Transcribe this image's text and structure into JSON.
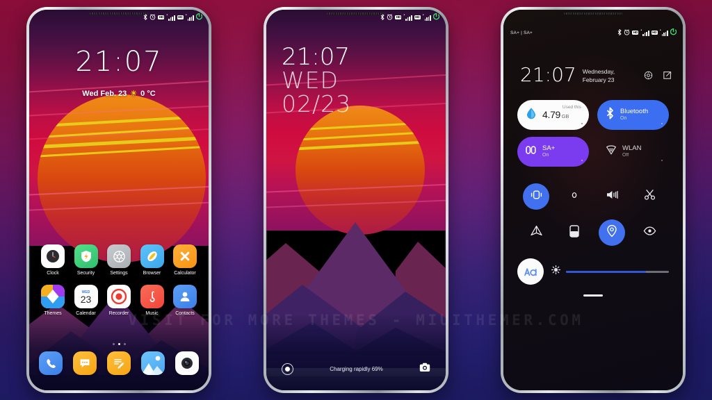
{
  "wallpaper_theme": "synthwave-sunset",
  "watermark": "VISIT FOR MORE THEMES - MIUITHEMER.COM",
  "colors": {
    "bg_top": "#b8114a",
    "bg_bottom": "#23227e",
    "accent_blue": "#3b6ef0",
    "accent_purple": "#7b3cf0",
    "battery_green": "#3fd96a",
    "sun_yellow": "#e8d21b"
  },
  "phone1": {
    "name": "home-screen",
    "statusbar": {
      "icons": [
        "bluetooth-icon",
        "alarm-icon",
        "hd-icon",
        "signal-bars-icon",
        "hd-icon",
        "signal-bars-icon",
        "battery-charging-icon"
      ]
    },
    "clock": "21:07",
    "date": "Wed Feb. 23",
    "weather_icon": "sun-icon",
    "temperature": "0 °C",
    "apps_row1": [
      {
        "label": "Clock",
        "icon": "clock-icon"
      },
      {
        "label": "Security",
        "icon": "shield-icon"
      },
      {
        "label": "Settings",
        "icon": "gear-icon"
      },
      {
        "label": "Browser",
        "icon": "browser-icon"
      },
      {
        "label": "Calculator",
        "icon": "calculator-icon"
      }
    ],
    "apps_row2": [
      {
        "label": "Themes",
        "icon": "themes-icon"
      },
      {
        "label": "Calendar",
        "icon": "calendar-icon",
        "day_name": "WED",
        "day_num": "23"
      },
      {
        "label": "Recorder",
        "icon": "recorder-icon"
      },
      {
        "label": "Music",
        "icon": "music-note-icon"
      },
      {
        "label": "Contacts",
        "icon": "person-icon"
      }
    ],
    "page_dots": 3,
    "page_active": 1,
    "dock": [
      {
        "icon": "phone-icon"
      },
      {
        "icon": "messages-icon"
      },
      {
        "icon": "notes-icon"
      },
      {
        "icon": "gallery-icon"
      },
      {
        "icon": "camera-icon"
      }
    ]
  },
  "phone2": {
    "name": "lock-screen",
    "statusbar": {
      "icons": [
        "bluetooth-icon",
        "alarm-icon",
        "hd-icon",
        "signal-bars-icon",
        "hd-icon",
        "signal-bars-icon",
        "battery-charging-icon"
      ]
    },
    "clock": "21:07",
    "day_of_week": "WED",
    "date": "02/23",
    "charging_text": "Charging rapidly 69%",
    "left_shortcut": "flashlight-icon",
    "right_shortcut": "camera-icon"
  },
  "phone3": {
    "name": "control-center",
    "statusbar_left": "SA+ | SA+",
    "statusbar": {
      "icons": [
        "bluetooth-icon",
        "alarm-icon",
        "hd-icon",
        "signal-bars-icon",
        "hd-icon",
        "signal-bars-icon",
        "battery-charging-icon"
      ]
    },
    "clock": "21:07",
    "date": "Wednesday, February 23",
    "header_icons": [
      "settings-gear-icon",
      "edit-tiles-icon"
    ],
    "tiles": [
      {
        "name": "data-usage",
        "icon": "data-drop-icon",
        "label_top": "Used this",
        "value": "4.79",
        "unit": "GB",
        "style": "light"
      },
      {
        "name": "bluetooth",
        "icon": "bluetooth-icon",
        "title": "Bluetooth",
        "sub": "On",
        "style": "blue"
      },
      {
        "name": "sa-plus",
        "icon": "sim-icon",
        "title": "SA+",
        "sub": "On",
        "style": "purple"
      },
      {
        "name": "wlan",
        "icon": "wifi-off-icon",
        "title": "WLAN",
        "sub": "Off",
        "style": "dark"
      }
    ],
    "toggles_row1": [
      {
        "name": "vibrate",
        "icon": "vibrate-icon",
        "active": true
      },
      {
        "name": "silent",
        "icon": "silent-icon",
        "active": false
      },
      {
        "name": "sound",
        "icon": "sound-icon",
        "active": false
      },
      {
        "name": "screenshot",
        "icon": "scissors-icon",
        "active": false
      }
    ],
    "toggles_row2": [
      {
        "name": "airplane",
        "icon": "airplane-icon",
        "active": false
      },
      {
        "name": "rotation",
        "icon": "rotation-icon",
        "active": false
      },
      {
        "name": "location",
        "icon": "location-icon",
        "active": true
      },
      {
        "name": "reading",
        "icon": "eye-icon",
        "active": false
      }
    ],
    "brightness": {
      "auto_icon": "auto-brightness-icon",
      "sun_icon": "brightness-icon",
      "percent": 78
    }
  }
}
